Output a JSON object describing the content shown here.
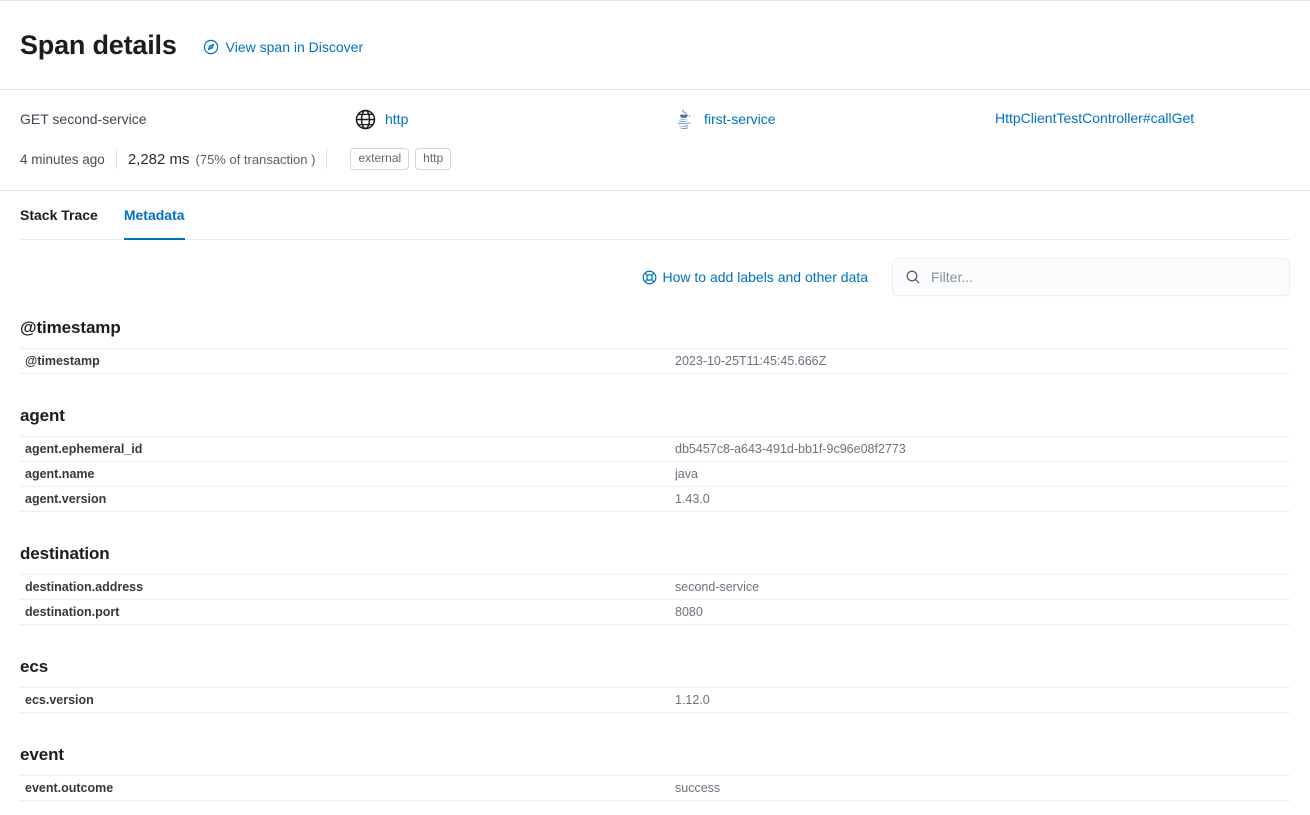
{
  "header": {
    "title": "Span details",
    "discover_link": "View span in Discover",
    "discover_icon": "compass-icon"
  },
  "summary": {
    "span_name": "GET second-service",
    "span_type": {
      "icon": "globe-icon",
      "label": "http"
    },
    "service": {
      "icon": "java-logo-icon",
      "label": "first-service"
    },
    "transaction_name": "HttpClientTestController#callGet",
    "timestamp_relative": "4 minutes ago",
    "duration": "2,282 ms",
    "duration_pct": "(75% of transaction )",
    "badges": [
      "external",
      "http"
    ]
  },
  "tabs": [
    {
      "label": "Stack Trace",
      "active": false
    },
    {
      "label": "Metadata",
      "active": true
    }
  ],
  "toolbar": {
    "help_link": "How to add labels and other data",
    "help_icon": "life-ring-icon",
    "search_icon": "search-icon",
    "filter_placeholder": "Filter...",
    "filter_value": ""
  },
  "colors": {
    "link": "#0071c2",
    "text": "#343741",
    "value_text": "#6b7280",
    "border": "#eceef2",
    "java_red": "#e76f51",
    "java_blue": "#3b72b8"
  },
  "metadata": [
    {
      "section": "@timestamp",
      "rows": [
        {
          "key": "@timestamp",
          "value": "2023-10-25T11:45:45.666Z"
        }
      ]
    },
    {
      "section": "agent",
      "rows": [
        {
          "key": "agent.ephemeral_id",
          "value": "db5457c8-a643-491d-bb1f-9c96e08f2773"
        },
        {
          "key": "agent.name",
          "value": "java"
        },
        {
          "key": "agent.version",
          "value": "1.43.0"
        }
      ]
    },
    {
      "section": "destination",
      "rows": [
        {
          "key": "destination.address",
          "value": "second-service"
        },
        {
          "key": "destination.port",
          "value": "8080"
        }
      ]
    },
    {
      "section": "ecs",
      "rows": [
        {
          "key": "ecs.version",
          "value": "1.12.0"
        }
      ]
    },
    {
      "section": "event",
      "rows": [
        {
          "key": "event.outcome",
          "value": "success"
        }
      ]
    }
  ]
}
